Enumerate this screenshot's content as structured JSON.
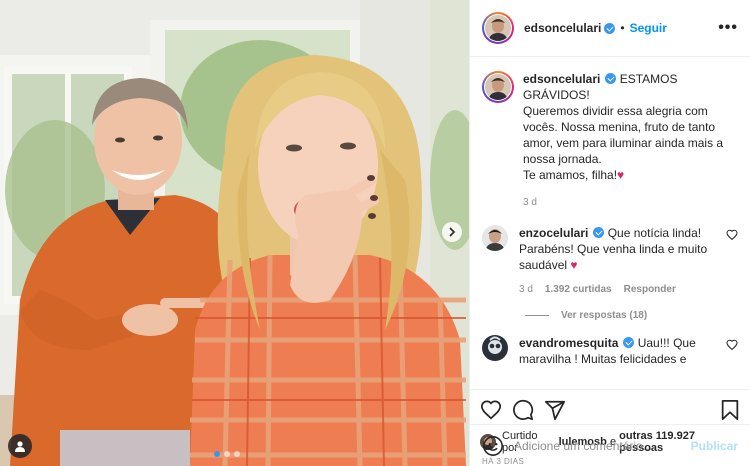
{
  "post": {
    "author": "edsoncelulari",
    "follow_label": "Seguir",
    "more_label": "•••",
    "separator": "•",
    "caption_lines": [
      "ESTAMOS GRÁVIDOS!",
      "Queremos dividir essa alegria com vocês. Nossa menina, fruto de tanto amor, vem para iluminar ainda mais a nossa jornada.",
      "Te amamos, filha!"
    ],
    "caption_age": "3 d",
    "heart_emoji": "♥"
  },
  "comments": [
    {
      "username": "enzocelulari",
      "text": "Que notícia linda! Parabéns! Que venha linda e muito saudável",
      "has_heart": true,
      "age": "3 d",
      "likes": "1.392 curtidas",
      "reply_label": "Responder",
      "view_replies": "Ver respostas (18)"
    },
    {
      "username": "evandromesquita",
      "text": "Uau!!! Que maravilha ! Muitas felicidades e"
    }
  ],
  "likes_line": {
    "prefix": "Curtido por",
    "user": "lulemosb",
    "connector": "e",
    "others": "outras 119.927 pessoas"
  },
  "date_label": "HÁ 3 DIAS",
  "comment_input": {
    "placeholder": "Adicione um comentário...",
    "publish_label": "Publicar"
  },
  "icons": {
    "user_tag": "user-tag-icon",
    "carousel_next": "chevron-right-icon",
    "like": "heart-icon",
    "comment": "comment-icon",
    "share": "paper-plane-icon",
    "save": "bookmark-icon",
    "emoji": "smiley-icon"
  },
  "colors": {
    "link_blue": "#0095f6",
    "verified_blue": "#3897f0",
    "muted": "#8e8e8e",
    "publish_disabled": "#b2dffc"
  }
}
